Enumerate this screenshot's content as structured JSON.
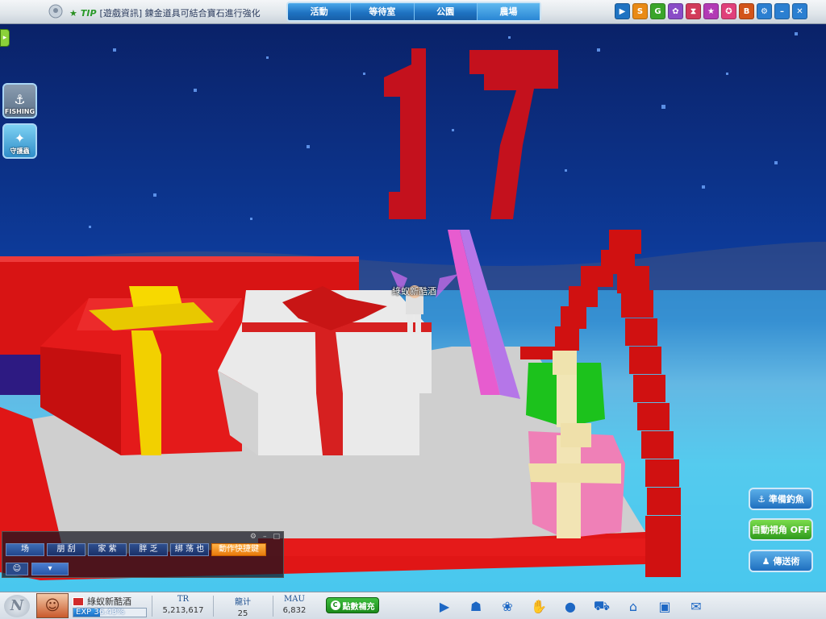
{
  "topbar": {
    "tip_label": "TIP",
    "tip_text": "[遊戲資訊] 鍊金道具可結合寶石進行強化",
    "nav_tabs": [
      "活動",
      "等待室",
      "公園",
      "農場"
    ],
    "sys_icons": [
      {
        "name": "play-icon",
        "glyph": "▶",
        "color": "#1f73c2"
      },
      {
        "name": "story-icon",
        "glyph": "S",
        "color": "#e98a16"
      },
      {
        "name": "g-icon",
        "glyph": "G",
        "color": "#3aa52a"
      },
      {
        "name": "gear-small-icon",
        "glyph": "✿",
        "color": "#8a4cc7"
      },
      {
        "name": "hourglass-icon",
        "glyph": "⧗",
        "color": "#d23a5a"
      },
      {
        "name": "lucky-icon",
        "glyph": "★",
        "color": "#b23ab5"
      },
      {
        "name": "star-icon",
        "glyph": "✪",
        "color": "#e0407a"
      },
      {
        "name": "book-icon",
        "glyph": "B",
        "color": "#d2541a"
      },
      {
        "name": "settings-icon",
        "glyph": "⚙",
        "color": "#2b7fd1"
      },
      {
        "name": "minimize-icon",
        "glyph": "–",
        "color": "#2b7fd1"
      },
      {
        "name": "close-icon",
        "glyph": "✕",
        "color": "#2b7fd1"
      }
    ]
  },
  "side": {
    "fishing_label": "FISHING",
    "guard_label": "守護蟲"
  },
  "scene": {
    "big_number": "17",
    "player_name": "綠蚁新酷酒"
  },
  "actions": {
    "prepare_rod": "準備釣魚",
    "auto_view": "自動視角 OFF",
    "teleport": "傳送術"
  },
  "chat": {
    "channels": [
      "场",
      "朋 刮",
      "家 紫",
      "胖 乏",
      "綁 荡 也"
    ],
    "quick_action": "動作快捷鍵",
    "emote": "☺",
    "select_value": "▾"
  },
  "status": {
    "character_name": "綠蚁新酷酒",
    "exp_label": "EXP 36.43%",
    "exp_percent": 36.43,
    "stats": [
      {
        "header": "TR",
        "value": "5,213,617"
      },
      {
        "header": "龍计",
        "value": "25"
      },
      {
        "header": "MAU",
        "value": "6,832"
      }
    ],
    "recharge_label": "點數補充",
    "menu_icons": [
      "next-icon",
      "friends-icon",
      "paw-icon",
      "handshake-icon",
      "apple-icon",
      "cart-icon",
      "home-icon",
      "briefcase-icon",
      "chat-icon"
    ]
  }
}
